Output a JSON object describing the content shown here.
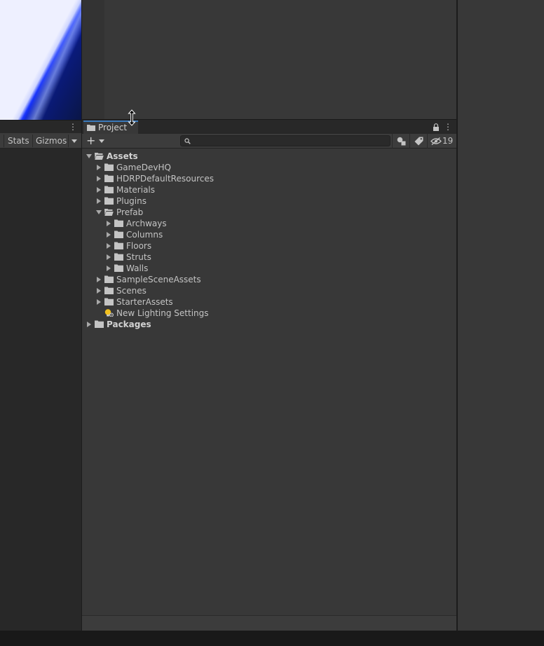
{
  "game_view": {
    "toolbar": {
      "stats_label": "Stats",
      "gizmos_label": "Gizmos"
    }
  },
  "project_window": {
    "tab_label": "Project",
    "search": {
      "value": "",
      "placeholder": ""
    },
    "hidden_packages_count": "19",
    "tree": [
      {
        "label": "Assets",
        "bold": true,
        "state": "expanded",
        "icon": "folder-open-icon"
      },
      {
        "label": "GameDevHQ",
        "state": "collapsed",
        "icon": "folder-icon"
      },
      {
        "label": "HDRPDefaultResources",
        "state": "collapsed",
        "icon": "folder-icon"
      },
      {
        "label": "Materials",
        "state": "collapsed",
        "icon": "folder-icon"
      },
      {
        "label": "Plugins",
        "state": "collapsed",
        "icon": "folder-icon"
      },
      {
        "label": "Prefab",
        "state": "expanded",
        "icon": "folder-open-icon"
      },
      {
        "label": "Archways",
        "state": "collapsed",
        "icon": "folder-icon"
      },
      {
        "label": "Columns",
        "state": "collapsed",
        "icon": "folder-icon"
      },
      {
        "label": "Floors",
        "state": "collapsed",
        "icon": "folder-icon"
      },
      {
        "label": "Struts",
        "state": "collapsed",
        "icon": "folder-icon"
      },
      {
        "label": "Walls",
        "state": "collapsed",
        "icon": "folder-icon"
      },
      {
        "label": "SampleSceneAssets",
        "state": "collapsed",
        "icon": "folder-icon"
      },
      {
        "label": "Scenes",
        "state": "collapsed",
        "icon": "folder-icon"
      },
      {
        "label": "StarterAssets",
        "state": "collapsed",
        "icon": "folder-icon"
      },
      {
        "label": "New Lighting Settings",
        "state": "none",
        "icon": "lighting-settings-icon"
      },
      {
        "label": "Packages",
        "bold": true,
        "state": "collapsed",
        "icon": "folder-icon"
      }
    ]
  },
  "colors": {
    "accent_tab": "#3a79bb",
    "panel_bg": "#383838",
    "toolbar_bg": "#3c3c3c",
    "text": "#c4c4c4",
    "lighting_icon": "#f2c01e"
  }
}
